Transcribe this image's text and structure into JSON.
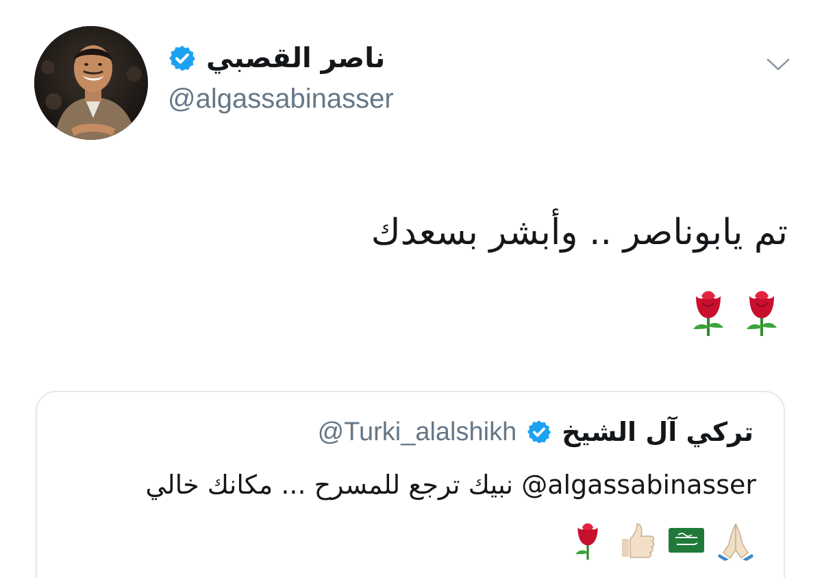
{
  "author": {
    "name": "ناصر القصبي",
    "handle": "@algassabinasser",
    "verified": true,
    "avatar_icon": "profile-photo"
  },
  "tweet": {
    "text": "تم يابوناصر .. وأبشر بسعدك",
    "emojis": [
      "rose-icon",
      "rose-icon"
    ]
  },
  "menu_icon": "chevron-down-icon",
  "quoted_tweet": {
    "name": "تركي آل الشيخ",
    "handle": "@Turki_alalshikh",
    "verified": true,
    "mention": "@algassabinasser",
    "text": " نبيك ترجع للمسرح ... مكانك خالي",
    "emojis": [
      "folded-hands-icon",
      "saudi-flag-icon",
      "thumbs-up-icon",
      "rose-icon"
    ]
  },
  "colors": {
    "verified_blue": "#1da1f2",
    "secondary_text": "#657786",
    "border": "#e1e8ed"
  }
}
